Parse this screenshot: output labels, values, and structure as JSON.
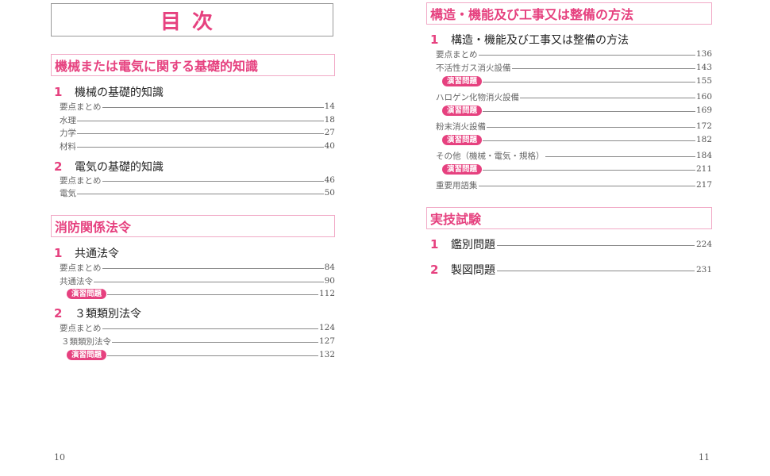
{
  "left": {
    "title": "目次",
    "section1": {
      "heading": "機械または電気に関する基礎的知識",
      "chapters": [
        {
          "num": "1",
          "title": "機械の基礎的知識",
          "items": [
            {
              "label": "要点まとめ",
              "page": "14"
            },
            {
              "label": "水理",
              "page": "18"
            },
            {
              "label": "力学",
              "page": "27"
            },
            {
              "label": "材料",
              "page": "40"
            }
          ]
        },
        {
          "num": "2",
          "title": "電気の基礎的知識",
          "items": [
            {
              "label": "要点まとめ",
              "page": "46"
            },
            {
              "label": "電気",
              "page": "50"
            }
          ]
        }
      ]
    },
    "section2": {
      "heading": "消防関係法令",
      "chapters": [
        {
          "num": "1",
          "title": "共通法令",
          "items": [
            {
              "label": "要点まとめ",
              "page": "84"
            },
            {
              "label": "共通法令",
              "page": "90"
            },
            {
              "label": "演習問題",
              "page": "112"
            }
          ]
        },
        {
          "num": "2",
          "title": "３類類別法令",
          "items": [
            {
              "label": "要点まとめ",
              "page": "124"
            },
            {
              "label": "３類類別法令",
              "page": "127"
            },
            {
              "label": "演習問題",
              "page": "132"
            }
          ]
        }
      ]
    },
    "folio": "10"
  },
  "right": {
    "section1": {
      "heading": "構造・機能及び工事又は整備の方法",
      "chapter": {
        "num": "1",
        "title": "構造・機能及び工事又は整備の方法"
      },
      "items": [
        {
          "label": "要点まとめ",
          "page": "136"
        },
        {
          "label": "不活性ガス消火設備",
          "page": "143"
        },
        {
          "label": "演習問題",
          "page": "155"
        },
        {
          "label": "ハロゲン化物消火設備",
          "page": "160"
        },
        {
          "label": "演習問題",
          "page": "169"
        },
        {
          "label": "粉末消火設備",
          "page": "172"
        },
        {
          "label": "演習問題",
          "page": "182"
        },
        {
          "label": "その他（機械・電気・規格）",
          "page": "184"
        },
        {
          "label": "演習問題",
          "page": "211"
        },
        {
          "label": "重要用語集",
          "page": "217"
        }
      ]
    },
    "section2": {
      "heading": "実技試験",
      "chapters": [
        {
          "num": "1",
          "title": "鑑別問題",
          "page": "224"
        },
        {
          "num": "2",
          "title": "製図問題",
          "page": "231"
        }
      ]
    },
    "folio": "11"
  },
  "colors": {
    "accent": "#e6417f",
    "border": "#f1a9c6"
  }
}
